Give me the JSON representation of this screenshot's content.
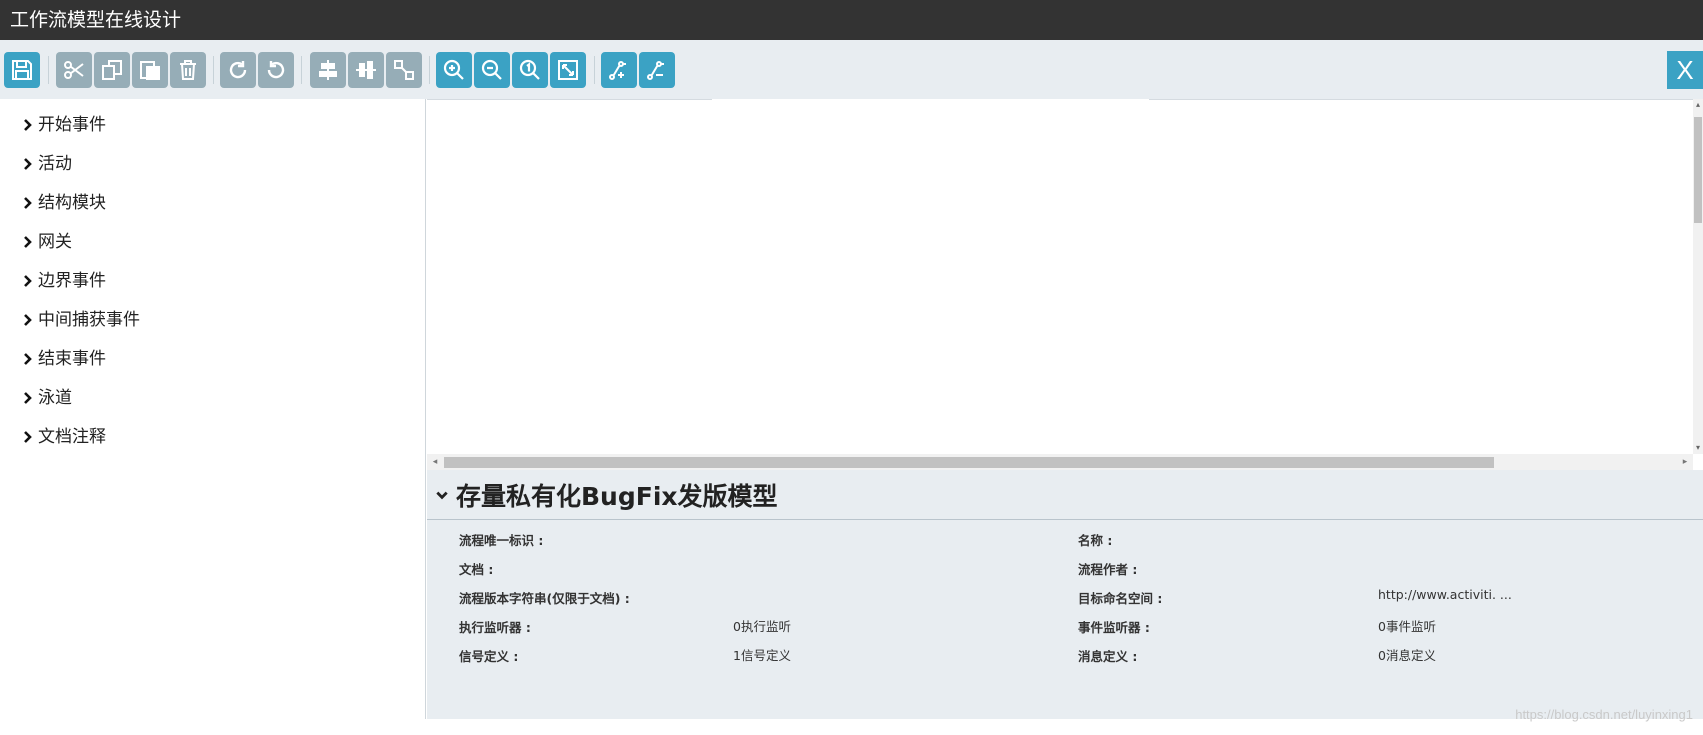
{
  "window": {
    "title": "工作流模型在线设计"
  },
  "toolbar": {
    "close_label": "X",
    "buttons": [
      {
        "icon": "save-icon",
        "group": "file"
      },
      {
        "icon": "cut-icon",
        "group": "edit"
      },
      {
        "icon": "copy-icon",
        "group": "edit"
      },
      {
        "icon": "paste-icon",
        "group": "edit"
      },
      {
        "icon": "delete-icon",
        "group": "edit"
      },
      {
        "icon": "redo-icon",
        "group": "history"
      },
      {
        "icon": "undo-icon",
        "group": "history"
      },
      {
        "icon": "align-horizontal-icon",
        "group": "align"
      },
      {
        "icon": "align-vertical-icon",
        "group": "align"
      },
      {
        "icon": "same-size-icon",
        "group": "align"
      },
      {
        "icon": "zoom-in-icon",
        "group": "zoom"
      },
      {
        "icon": "zoom-out-icon",
        "group": "zoom"
      },
      {
        "icon": "zoom-actual-icon",
        "group": "zoom"
      },
      {
        "icon": "zoom-fit-icon",
        "group": "zoom"
      },
      {
        "icon": "add-bendpoint-icon",
        "group": "bendpoint"
      },
      {
        "icon": "remove-bendpoint-icon",
        "group": "bendpoint"
      }
    ],
    "colors": {
      "active": "#3ba2c4",
      "disabled": "#96adb7"
    }
  },
  "palette": {
    "groups": [
      "开始事件",
      "活动",
      "结构模块",
      "网关",
      "边界事件",
      "中间捕获事件",
      "结束事件",
      "泳道",
      "文档注释"
    ]
  },
  "properties": {
    "title": "存量私有化BugFix发版模型",
    "rows": [
      {
        "left_label": "流程唯一标识 :",
        "left_value": "",
        "right_label": "名称 :",
        "right_value": ""
      },
      {
        "left_label": "文档 :",
        "left_value": "",
        "right_label": "流程作者 :",
        "right_value": ""
      },
      {
        "left_label": "流程版本字符串(仅限于文档) :",
        "left_value": "",
        "right_label": "目标命名空间 :",
        "right_value": "http://www.activiti. ..."
      },
      {
        "left_label": "执行监听器 :",
        "left_value": "0执行监听",
        "right_label": "事件监听器 :",
        "right_value": "0事件监听"
      },
      {
        "left_label": "信号定义 :",
        "left_value": "1信号定义",
        "right_label": "消息定义 :",
        "right_value": "0消息定义"
      }
    ]
  },
  "watermark": "https://blog.csdn.net/luyinxing1"
}
